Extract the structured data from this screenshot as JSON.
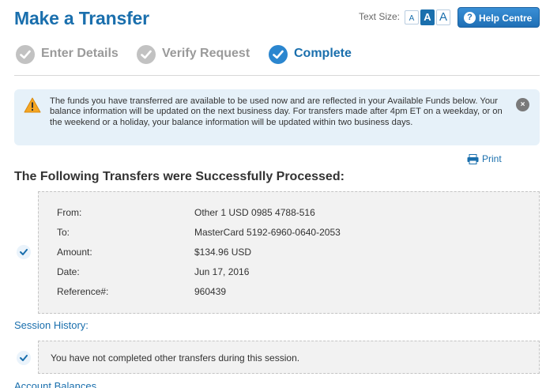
{
  "page": {
    "title": "Make a Transfer"
  },
  "toolbar": {
    "text_size_label": "Text Size:",
    "text_size_options": [
      "A",
      "A",
      "A"
    ],
    "help_label": "Help Centre",
    "help_icon": "?"
  },
  "steps": [
    {
      "label": "Enter Details",
      "state": "done"
    },
    {
      "label": "Verify Request",
      "state": "done"
    },
    {
      "label": "Complete",
      "state": "active"
    }
  ],
  "alert": {
    "text": "The funds you have transferred are available to be used now and are reflected in your Available Funds below. Your balance information will be updated on the next business day. For transfers made after 4pm ET on a weekday, or on the weekend or a holiday, your balance information will be updated within two business days.",
    "close_icon": "×"
  },
  "print": {
    "label": "Print"
  },
  "transfers": {
    "heading": "The Following Transfers were Successfully Processed:",
    "rows": [
      {
        "label": "From:",
        "value": "Other 1 USD 0985 4788-516"
      },
      {
        "label": "To:",
        "value": "MasterCard 5192-6960-0640-2053"
      },
      {
        "label": "Amount:",
        "value": "$134.96 USD"
      },
      {
        "label": "Date:",
        "value": "Jun 17, 2016"
      },
      {
        "label": "Reference#:",
        "value": "960439"
      }
    ]
  },
  "session": {
    "heading": "Session History:",
    "message": "You have not completed other transfers during this session."
  },
  "balances": {
    "heading": "Account Balances"
  },
  "colors": {
    "brand": "#1a6fad",
    "accent": "#2b86cf",
    "alert_bg": "#e6f1f9",
    "warning": "#f5a623"
  }
}
